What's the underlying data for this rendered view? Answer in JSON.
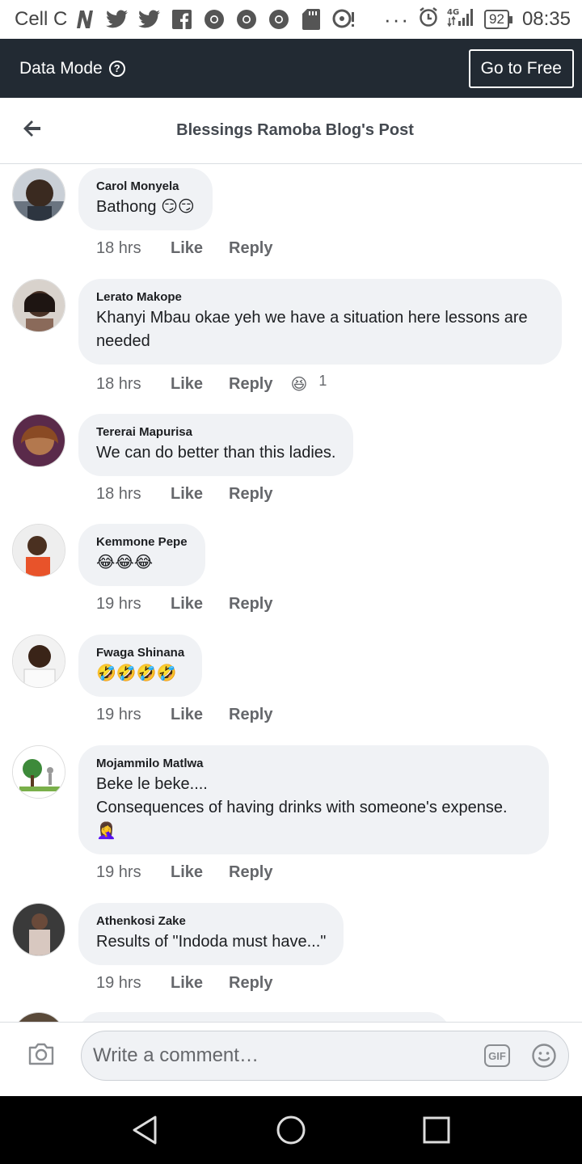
{
  "status_bar": {
    "carrier": "Cell C",
    "battery": "92",
    "time": "08:35",
    "notification_icons": [
      "n-icon",
      "twitter-icon",
      "twitter-icon",
      "facebook-icon",
      "chrome-icon",
      "chrome-icon",
      "chrome-icon",
      "sd-card-icon",
      "hotspot-icon"
    ],
    "overflow": "···"
  },
  "data_mode": {
    "label": "Data Mode",
    "help_glyph": "?",
    "button_label": "Go to Free"
  },
  "header": {
    "title": "Blessings Ramoba Blog's Post"
  },
  "comments": [
    {
      "name": "Carol Monyela",
      "text": "Bathong 😏😏",
      "time": "18 hrs",
      "like": "Like",
      "reply": "Reply"
    },
    {
      "name": "Lerato Makope",
      "text": "Khanyi Mbau okae yeh we have a situation here lessons are needed",
      "time": "18 hrs",
      "like": "Like",
      "reply": "Reply",
      "reaction": {
        "emoji": "😆",
        "count": "1"
      }
    },
    {
      "name": "Tererai Mapurisa",
      "text": "We can do better than this ladies.",
      "time": "18 hrs",
      "like": "Like",
      "reply": "Reply"
    },
    {
      "name": "Kemmone Pepe",
      "text": "😂😂😂",
      "time": "19 hrs",
      "like": "Like",
      "reply": "Reply"
    },
    {
      "name": "Fwaga Shinana",
      "text": "🤣🤣🤣🤣",
      "time": "19 hrs",
      "like": "Like",
      "reply": "Reply"
    },
    {
      "name": "Mojammilo Matlwa",
      "text": "Beke le beke....\nConsequences of having drinks with someone's expense.\n🤦‍♀️",
      "time": "19 hrs",
      "like": "Like",
      "reply": "Reply"
    },
    {
      "name": "Athenkosi Zake",
      "text": "Results of \"Indoda must have...\"",
      "time": "19 hrs",
      "like": "Like",
      "reply": "Reply"
    }
  ],
  "comment_bar": {
    "placeholder": "Write a comment…",
    "gif_label": "GIF"
  }
}
